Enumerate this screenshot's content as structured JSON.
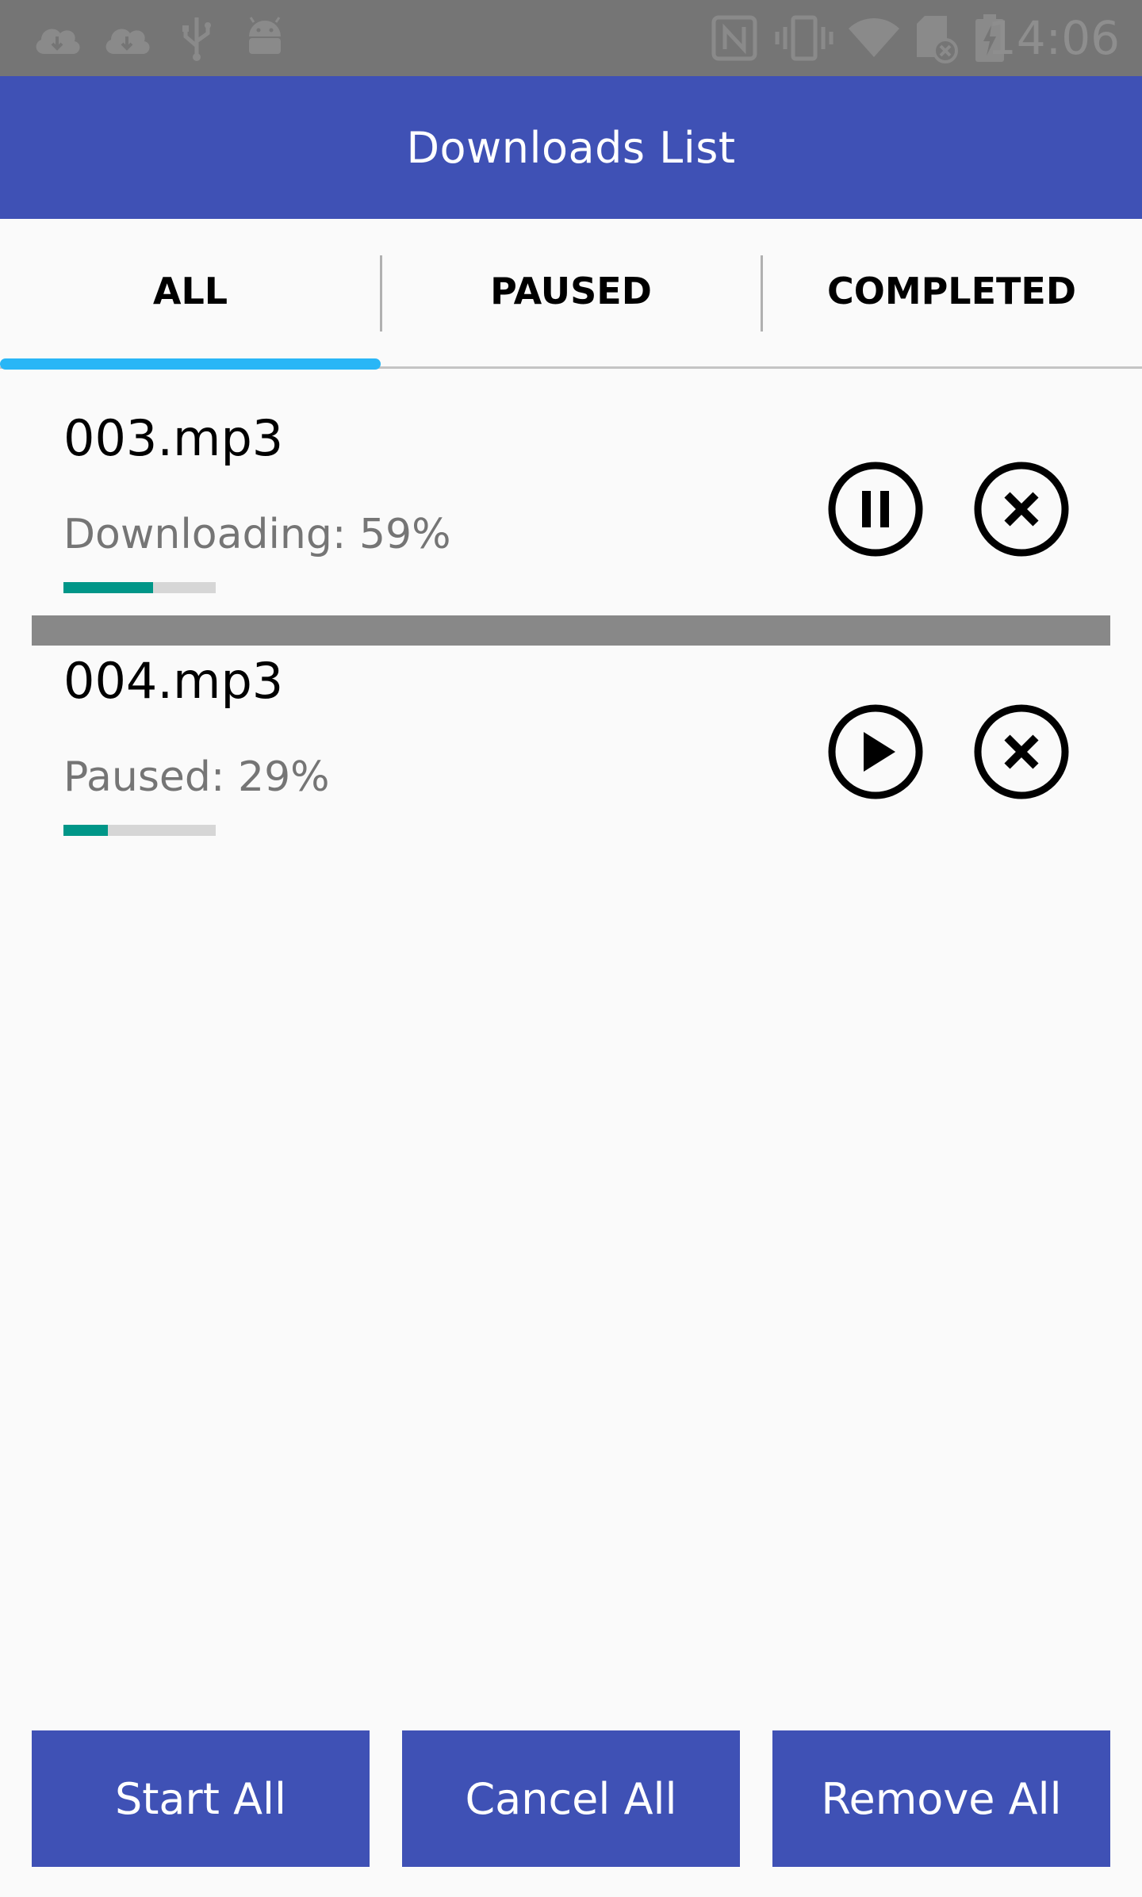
{
  "status_bar": {
    "time": "14:06",
    "left_icons": [
      "cloud-download-icon",
      "cloud-download-icon",
      "usb-icon",
      "android-icon"
    ],
    "right_icons": [
      "nfc-icon",
      "vibrate-icon",
      "wifi-icon",
      "sd-card-icon",
      "battery-charging-icon"
    ]
  },
  "app_bar": {
    "title": "Downloads List",
    "color": "#3f51b5"
  },
  "tabs": [
    {
      "label": "ALL",
      "selected": true
    },
    {
      "label": "PAUSED",
      "selected": false
    },
    {
      "label": "COMPLETED",
      "selected": false
    }
  ],
  "downloads": [
    {
      "file_name": "003.mp3",
      "status": "Downloading: 59%",
      "progress": 0.59,
      "primary_action_icon": "pause-icon",
      "secondary_action_icon": "cancel-icon"
    },
    {
      "file_name": "004.mp3",
      "status": "Paused: 29%",
      "progress": 0.29,
      "primary_action_icon": "play-icon",
      "secondary_action_icon": "cancel-icon"
    }
  ],
  "bottom_buttons": {
    "start_all": "Start All",
    "cancel_all": "Cancel All",
    "remove_all": "Remove All"
  },
  "colors": {
    "primary": "#3f51b5",
    "tab_indicator": "#29b6f6",
    "progress": "#009688"
  }
}
